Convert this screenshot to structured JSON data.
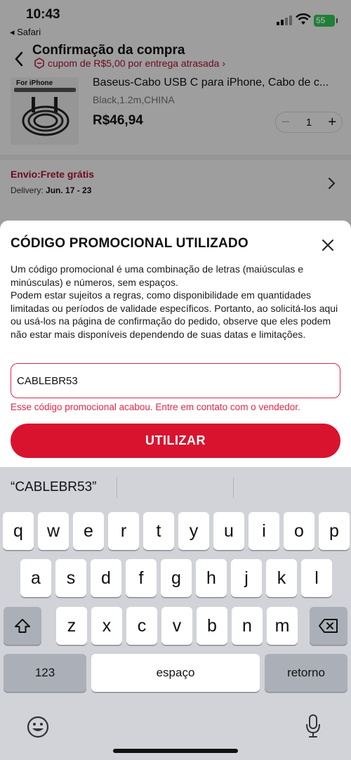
{
  "status_bar": {
    "time": "10:43",
    "back_app": "◂ Safari",
    "battery": "55"
  },
  "header": {
    "title": "Confirmação da compra",
    "coupon_text": "cupom de R$5,00 por entrega atrasada",
    "coupon_chevron": "›"
  },
  "product": {
    "image_tag": "For iPhone",
    "name": "Baseus-Cabo USB C para iPhone, Cabo de c...",
    "variant": "Black,1.2m,CHINA",
    "price": "R$46,94",
    "quantity": "1",
    "minus": "−",
    "plus": "+"
  },
  "shipping": {
    "title": "Envio:Frete grátis",
    "label": "Delivery: ",
    "date": "Jun. 17 - 23"
  },
  "sheet": {
    "title": "CÓDIGO PROMOCIONAL UTILIZADO",
    "description": "Um código promocional é uma combinação de letras (maiúsculas e minúsculas) e números, sem espaços.\nPodem estar sujeitos a regras, como disponibilidade em quantidades limitadas ou períodos de validade específicos. Portanto, ao solicitá-los aqui ou usá-los na página de confirmação do pedido, observe que eles podem não estar mais disponíveis dependendo de suas datas e limitações.",
    "input_value": "CABLEBR53",
    "error": "Esse código promocional acabou. Entre em contato com o vendedor.",
    "button": "UTILIZAR"
  },
  "keyboard": {
    "suggestion": "“CABLEBR53”",
    "row1": [
      "q",
      "w",
      "e",
      "r",
      "t",
      "y",
      "u",
      "i",
      "o",
      "p"
    ],
    "row2": [
      "a",
      "s",
      "d",
      "f",
      "g",
      "h",
      "j",
      "k",
      "l"
    ],
    "row3": [
      "z",
      "x",
      "c",
      "v",
      "b",
      "n",
      "m"
    ],
    "numbers_key": "123",
    "space_key": "espaço",
    "return_key": "retorno"
  },
  "colors": {
    "accent": "#d9132e",
    "error": "#e0284b",
    "coupon": "#b01232"
  }
}
